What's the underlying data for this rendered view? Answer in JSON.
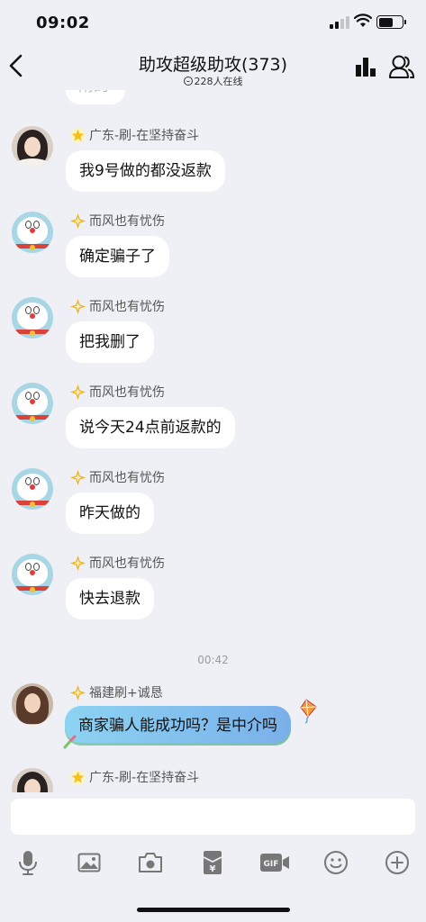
{
  "status_bar": {
    "time": "09:02"
  },
  "header": {
    "title": "助攻超级助攻(373)",
    "online_count": "228人在线"
  },
  "chat": {
    "peek_text": "附的",
    "messages": [
      {
        "sender": "广东-刷-在坚持奋斗",
        "text": "我9号做的都没返款",
        "avatar": "girl-avatar",
        "badge": "star-badge-icon"
      },
      {
        "sender": "而风也有忧伤",
        "text": "确定骗子了",
        "avatar": "doraemon-avatar",
        "badge": "sparkle-badge-icon"
      },
      {
        "sender": "而风也有忧伤",
        "text": "把我删了",
        "avatar": "doraemon-avatar",
        "badge": "sparkle-badge-icon"
      },
      {
        "sender": "而风也有忧伤",
        "text": "说今天24点前返款的",
        "avatar": "doraemon-avatar",
        "badge": "sparkle-badge-icon"
      },
      {
        "sender": "而风也有忧伤",
        "text": "昨天做的",
        "avatar": "doraemon-avatar",
        "badge": "sparkle-badge-icon"
      },
      {
        "sender": "而风也有忧伤",
        "text": "快去退款",
        "avatar": "doraemon-avatar",
        "badge": "sparkle-badge-icon"
      }
    ],
    "time_divider": "00:42",
    "special_message": {
      "sender": "福建刷+诚恳",
      "text": "商家骗人能成功吗？是中介吗",
      "avatar": "woman-avatar",
      "badge": "sparkle-badge-icon"
    },
    "last_sender": {
      "sender": "广东-刷-在坚持奋斗",
      "avatar": "girl-avatar",
      "badge": "star-badge-icon"
    }
  },
  "toolbar": {
    "icons": [
      "microphone-icon",
      "image-icon",
      "camera-icon",
      "red-packet-icon",
      "gif-icon",
      "emoji-icon",
      "plus-icon"
    ],
    "gif_label": "GIF",
    "yen_label": "¥"
  },
  "colors": {
    "background": "#eef0f5",
    "bubble": "#ffffff",
    "special_bubble_start": "#8cd3f2",
    "special_bubble_end": "#7ab0ea",
    "star_badge": "#f5c21b",
    "sparkle_badge": "#f2b31a"
  }
}
